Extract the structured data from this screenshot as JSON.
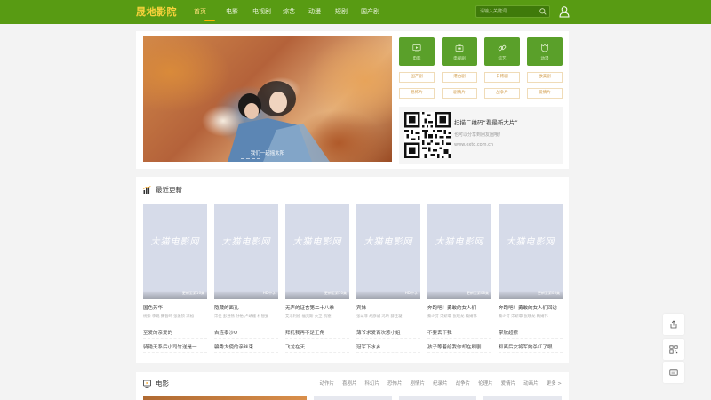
{
  "header": {
    "logo": "晟地影院",
    "nav": [
      {
        "label": "首页",
        "active": true
      },
      {
        "label": "电影"
      },
      {
        "label": "电视剧"
      },
      {
        "label": "综艺"
      },
      {
        "label": "动漫"
      },
      {
        "label": "短剧"
      },
      {
        "label": "国产剧"
      }
    ],
    "search_placeholder": "请输入关键词"
  },
  "hero": {
    "caption": "我们一起摇太阳"
  },
  "quick_links": [
    {
      "label": "电影",
      "icon": "play-icon"
    },
    {
      "label": "电视剧",
      "icon": "tv-icon"
    },
    {
      "label": "综艺",
      "icon": "link-icon"
    },
    {
      "label": "动漫",
      "icon": "shield-icon"
    }
  ],
  "categories": [
    "国产剧",
    "港台剧",
    "日韩剧",
    "欧美剧",
    "恐怖片",
    "剧情片",
    "战争片",
    "爱情片"
  ],
  "qr": {
    "title": "扫描二维码“看最新大片”",
    "subtitle": "也可以分享到朋友圈哦！",
    "url": "www.exto.com.cn"
  },
  "recent": {
    "title": "最近更新",
    "watermark": "大猫电影网",
    "movies": [
      {
        "title": "国色芳华",
        "cast": "杨紫 李现 魏哲鸣 张雅钦 凉松",
        "badge": "更新至第16集"
      },
      {
        "title": "隐藏的面孔",
        "cast": "宋佳 彭昱畅 孙怡 卢靖姗 朴智旻",
        "badge": "HD中字"
      },
      {
        "title": "无声的证言第二十八季",
        "cast": "艾米利娅·福克斯 大卫·凯德",
        "badge": "更新至第10集"
      },
      {
        "title": "宾妹",
        "cast": "张以菲 胡彦斌 冯昕 薛佳凝",
        "badge": "HD中字"
      },
      {
        "title": "奔跑吧！勇敢的女人们",
        "cast": "蔡少芬 宋妍霏 张晓龙 鞠婧祎",
        "badge": "更新至第08集"
      },
      {
        "title": "奔跑吧！勇敢的女人们回访",
        "cast": "蔡少芬 宋妍霏 张晓龙 鞠婧祎",
        "badge": "更新至第05集"
      }
    ],
    "text_links": [
      "至爱的亲爱的",
      "古连泰沙U",
      "拜托我再不是王角",
      "薄爷求爱百次惹小姐",
      "不要丢下我",
      "掌舵超撩",
      "骑艳天系后小司竹送是一",
      "骗秀大使的亲丝束",
      "飞龙在天",
      "冠军下水乡",
      "孩子等着给我你却在刷剧",
      "和离后女将军她杀红了眼"
    ]
  },
  "movie_section": {
    "title": "电影",
    "tabs": [
      "动作片",
      "喜剧片",
      "科幻片",
      "恐怖片",
      "剧情片",
      "纪录片",
      "战争片",
      "伦理片",
      "爱情片",
      "动画片",
      "更多 >"
    ]
  },
  "colors": {
    "header_bg": "#589b13",
    "logo": "#f7d23b",
    "accent": "#ffb400",
    "tile_green": "#5aa02a"
  }
}
